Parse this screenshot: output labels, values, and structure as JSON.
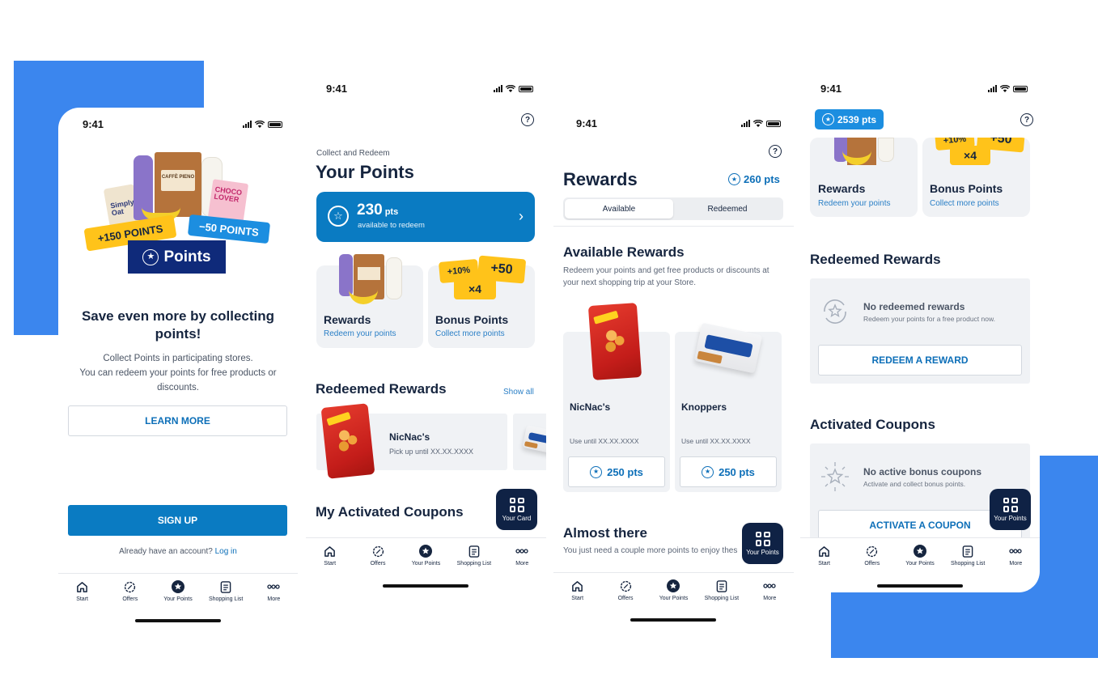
{
  "colors": {
    "accent": "#0a7bc2",
    "navy": "#0f2245",
    "yellow": "#ffc31a",
    "bg_blue": "#3b86ee"
  },
  "status": {
    "time": "9:41"
  },
  "tabs": [
    {
      "label": "Start",
      "icon": "home-icon"
    },
    {
      "label": "Offers",
      "icon": "offers-icon"
    },
    {
      "label": "Your Points",
      "icon": "star-icon"
    },
    {
      "label": "Shopping List",
      "icon": "list-icon"
    },
    {
      "label": "More",
      "icon": "more-icon"
    }
  ],
  "screen1": {
    "hero": {
      "plus_tag": "+150 POINTS",
      "minus_tag": "−50 POINTS",
      "brand": "Points",
      "product_a": "Simply Oat",
      "product_b": "CAFFÈ PIENO",
      "product_c": "CHOCO LOVER"
    },
    "headline": "Save even more by collecting points!",
    "body_line1": "Collect Points in participating stores.",
    "body_line2": "You can redeem your points for free products or discounts.",
    "learn_more": "LEARN MORE",
    "sign_up": "SIGN UP",
    "already": "Already have an account?",
    "login": "Log in"
  },
  "screen2": {
    "eyebrow": "Collect and Redeem",
    "title": "Your Points",
    "points_value": "230",
    "points_unit": "pts",
    "points_sub": "available to redeem",
    "rewards_title": "Rewards",
    "rewards_sub": "Redeem your points",
    "bonus_title": "Bonus Points",
    "bonus_sub": "Collect more points",
    "bonus_tag1": "+10%",
    "bonus_tag2": "+50",
    "bonus_tag3": "×4",
    "redeemed_title": "Redeemed Rewards",
    "show_all": "Show all",
    "redeemed_item": "NicNac's",
    "redeemed_pickup": "Pick up until  XX.XX.XXXX",
    "coupons_title": "My Activated Coupons",
    "fab": "Your Card"
  },
  "screen3": {
    "title": "Rewards",
    "points": "260 pts",
    "seg_available": "Available",
    "seg_redeemed": "Redeemed",
    "section": "Available Rewards",
    "desc": "Redeem your points and get free products or discounts at your next shopping trip at your  Store.",
    "items": [
      {
        "name": "NicNac's",
        "until": "Use until XX.XX.XXXX",
        "price": "250 pts"
      },
      {
        "name": "Knoppers",
        "until": "Use until XX.XX.XXXX",
        "price": "250 pts"
      }
    ],
    "almost": "Almost there",
    "almost_sub": "You just need a couple more points to enjoy thes",
    "fab": "Your Points"
  },
  "screen4": {
    "points": "2539 pts",
    "rewards_title": "Rewards",
    "rewards_sub": "Redeem your points",
    "bonus_title": "Bonus Points",
    "bonus_sub": "Collect more points",
    "bonus_tag1": "+10%",
    "bonus_tag2": "+50",
    "bonus_tag3": "×4",
    "redeemed_title": "Redeemed Rewards",
    "no_redeemed": "No redeemed rewards",
    "no_redeemed_sub": "Redeem your points for a free product now.",
    "redeem_btn": "REDEEM A REWARD",
    "coupons_title": "Activated Coupons",
    "no_coupons": "No active bonus coupons",
    "no_coupons_sub": "Activate and collect bonus points.",
    "activate_btn": "ACTIVATE A COUPON",
    "fab": "Your Points"
  }
}
